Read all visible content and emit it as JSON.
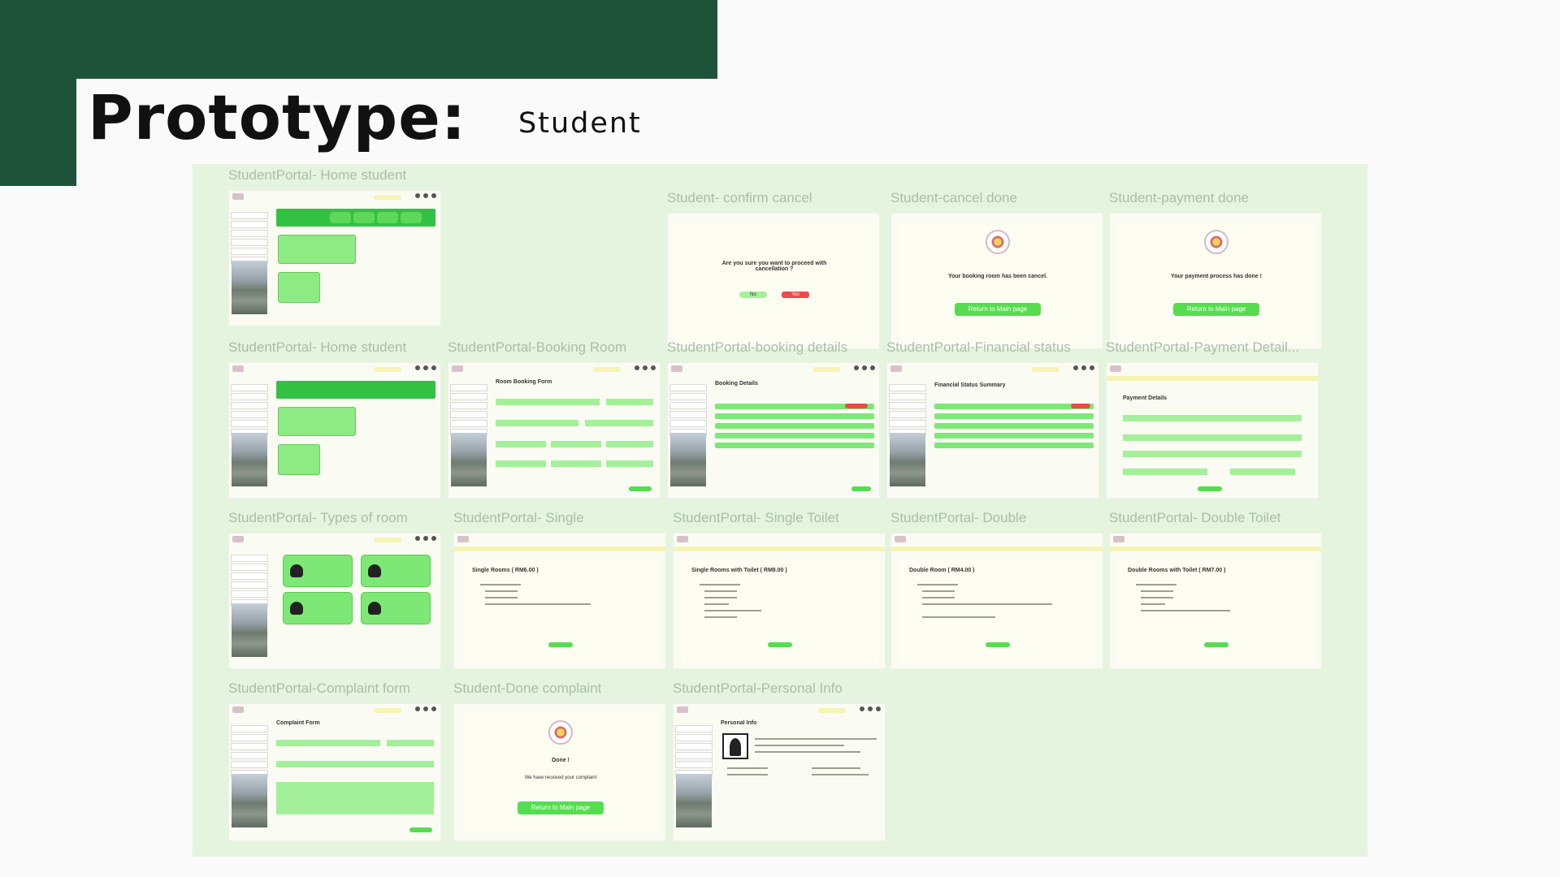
{
  "slide": {
    "title": "Prototype:",
    "subtitle": "Student"
  },
  "frames": {
    "home1": {
      "label": "StudentPortal- Home student"
    },
    "confirm_cancel": {
      "label": "Student- confirm cancel",
      "question": "Are you sure you want to proceed with cancellation ?",
      "no": "No",
      "yes": "Yes"
    },
    "cancel_done": {
      "label": "Student-cancel done",
      "message": "Your booking room has been cancel.",
      "button": "Return to Main page"
    },
    "payment_done": {
      "label": "Student-payment done",
      "message": "Your payment process has done !",
      "button": "Return to Main page"
    },
    "home2": {
      "label": "StudentPortal- Home student"
    },
    "booking_room": {
      "label": "StudentPortal-Booking Room",
      "heading": "Room Booking Form"
    },
    "booking_details": {
      "label": "StudentPortal-booking details",
      "heading": "Booking Details"
    },
    "financial": {
      "label": "StudentPortal-Financial status",
      "heading": "Financial Status Summary"
    },
    "payment_details": {
      "label": "StudentPortal-Payment Detail...",
      "heading": "Payment Details"
    },
    "types": {
      "label": "StudentPortal- Types of room"
    },
    "single": {
      "label": "StudentPortal- Single",
      "heading": "Single Rooms ( RM6.00 )"
    },
    "single_toilet": {
      "label": "StudentPortal- Single Toilet",
      "heading": "Single Rooms with Toilet ( RM8.00 )"
    },
    "double": {
      "label": "StudentPortal- Double",
      "heading": "Double Room ( RM4.00 )"
    },
    "double_toilet": {
      "label": "StudentPortal- Double Toilet",
      "heading": "Double Rooms with Toilet ( RM7.00 )"
    },
    "complaint_form": {
      "label": "StudentPortal-Complaint form",
      "heading": "Complaint Form"
    },
    "done_complaint": {
      "label": "Student-Done complaint",
      "title": "Done !",
      "message": "We have received your complaint",
      "button": "Return to Main page"
    },
    "personal": {
      "label": "StudentPortal-Personal Info",
      "heading": "Personal Info"
    }
  }
}
